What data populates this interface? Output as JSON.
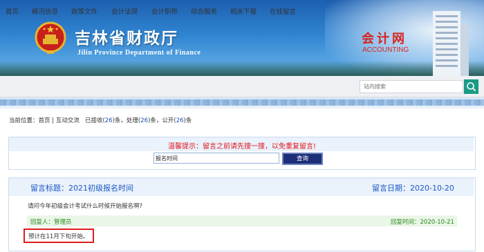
{
  "header": {
    "title": "吉林省财政厅",
    "subtitle": "Jilin Province Department of Finance",
    "badge_cn": "会计网",
    "badge_en": "ACCOUNTING"
  },
  "nav": {
    "items": [
      "首页",
      "概况信息",
      "政策文件",
      "会计法规",
      "会计职称",
      "综合服务",
      "相关下载",
      "在线留言"
    ],
    "search_placeholder": "站内搜索"
  },
  "breadcrumb": {
    "prefix": "当前位置：",
    "home": "首页",
    "separator": "|",
    "section": "互动交流",
    "received_label": "已接收(",
    "received": "26",
    "processed_label": ")条，处理(",
    "processed": "26",
    "public_label": ")条，公开(",
    "public": "26",
    "suffix": ")条"
  },
  "notice": {
    "text": "温馨提示：留言之前请先搜一搜，以免重复留言!",
    "query_value": "报名时间",
    "query_button": "查询"
  },
  "message": {
    "title_label": "留言标题：",
    "title": "2021初级报名时间",
    "date_label": "留言日期：",
    "date": "2020-10-20",
    "question": "请问今年初级会计考试什么时候开始报名啊?",
    "reply_by_label": "回复人：",
    "reply_by": "管理员",
    "reply_time_label": "回复时间：",
    "reply_time": "2020-10-21",
    "answer": "预计在11月下旬开始。"
  },
  "colors": {
    "accent_blue": "#1a58c4",
    "warning_red": "#e0161b",
    "reply_green": "#2a8a1e",
    "button_navy": "#1c2f78",
    "search_teal": "#1b9a86"
  }
}
